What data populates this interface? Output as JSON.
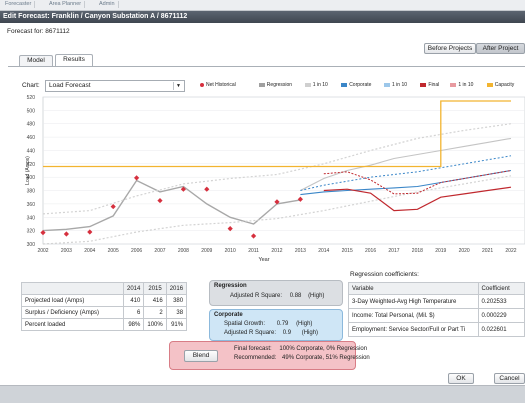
{
  "top_tabs": [
    "Forecaster",
    "Area Planner",
    "Admin"
  ],
  "window_title": "Edit Forecast: Franklin / Canyon Substation A / 8671112",
  "forecast_for_label": "Forecast for:",
  "forecast_for_value": "8671112",
  "buttons": {
    "before_projects": "Before Projects",
    "after_projects": "After Project",
    "blend": "Blend",
    "ok": "OK",
    "cancel": "Cancel"
  },
  "tabs": [
    {
      "label": "Model"
    },
    {
      "label": "Results"
    }
  ],
  "chart_label": "Chart:",
  "chart_select_value": "Load Forecast",
  "legend": [
    {
      "label": "Net Historical",
      "color": "#d6303e"
    },
    {
      "label": "Regression",
      "color": "#a0a0a0"
    },
    {
      "label": "1 in 10",
      "color": "#cfcfcf"
    },
    {
      "label": "Corporate",
      "color": "#3a86c8"
    },
    {
      "label": "1 in 10",
      "color": "#9cc7ea"
    },
    {
      "label": "Final",
      "color": "#c0282e"
    },
    {
      "label": "1 in 10",
      "color": "#e89aa0"
    },
    {
      "label": "Capacity",
      "color": "#f2b430"
    }
  ],
  "chart_data": {
    "type": "line",
    "xlabel": "Year",
    "ylabel": "Load (Amps)",
    "ylim": [
      300,
      520
    ],
    "xlim": [
      2002,
      2022
    ],
    "yticks": [
      300,
      320,
      340,
      360,
      380,
      400,
      420,
      440,
      460,
      480,
      500,
      520
    ],
    "xticks": [
      2002,
      2003,
      2004,
      2005,
      2006,
      2007,
      2008,
      2009,
      2010,
      2011,
      2012,
      2013,
      2014,
      2015,
      2016,
      2017,
      2018,
      2019,
      2020,
      2021,
      2022
    ],
    "series": [
      {
        "name": "Net Historical",
        "x": [
          2002,
          2003,
          2004,
          2005,
          2006,
          2007,
          2008,
          2009,
          2010,
          2011,
          2012,
          2013
        ],
        "y": [
          317,
          315,
          318,
          356,
          399,
          365,
          382,
          382,
          323,
          312,
          363,
          367
        ]
      },
      {
        "name": "Regression",
        "x": [
          2002,
          2003,
          2004,
          2005,
          2006,
          2007,
          2008,
          2009,
          2010,
          2011,
          2012,
          2013
        ],
        "y": [
          320,
          322,
          326,
          342,
          395,
          378,
          386,
          360,
          340,
          330,
          360,
          366
        ]
      },
      {
        "name": "1 in 10 (Regression) upper",
        "x": [
          2002,
          2004,
          2006,
          2008,
          2010,
          2012,
          2014,
          2016,
          2018,
          2020,
          2022
        ],
        "y": [
          345,
          350,
          372,
          390,
          398,
          404,
          420,
          440,
          458,
          470,
          480
        ]
      },
      {
        "name": "1 in 10 (Regression) lower",
        "x": [
          2002,
          2004,
          2006,
          2008,
          2010,
          2012,
          2014,
          2016,
          2018,
          2020,
          2022
        ],
        "y": [
          300,
          304,
          318,
          328,
          332,
          338,
          350,
          364,
          378,
          390,
          402
        ]
      },
      {
        "name": "Regression forecast",
        "x": [
          2013,
          2014,
          2015,
          2016,
          2017,
          2018,
          2019,
          2020,
          2021,
          2022
        ],
        "y": [
          380,
          398,
          410,
          418,
          428,
          434,
          440,
          446,
          452,
          458
        ]
      },
      {
        "name": "Corporate",
        "x": [
          2013,
          2014,
          2015,
          2016,
          2017,
          2018,
          2019,
          2020,
          2021,
          2022
        ],
        "y": [
          374,
          378,
          380,
          382,
          384,
          386,
          392,
          398,
          404,
          410
        ]
      },
      {
        "name": "1 in 10 (Corporate)",
        "x": [
          2013,
          2014,
          2015,
          2016,
          2017,
          2018,
          2019,
          2020,
          2021,
          2022
        ],
        "y": [
          380,
          388,
          394,
          400,
          404,
          408,
          414,
          420,
          426,
          432
        ]
      },
      {
        "name": "Final",
        "x": [
          2014,
          2015,
          2016,
          2017,
          2018,
          2019,
          2020,
          2021,
          2022
        ],
        "y": [
          380,
          382,
          376,
          350,
          352,
          370,
          375,
          380,
          385
        ]
      },
      {
        "name": "1 in 10 (Final)",
        "x": [
          2014,
          2015,
          2016,
          2017,
          2018,
          2019,
          2020,
          2021,
          2022
        ],
        "y": [
          405,
          408,
          396,
          375,
          376,
          392,
          398,
          404,
          410
        ]
      },
      {
        "name": "Capacity",
        "x": [
          2002,
          2019,
          2019,
          2022
        ],
        "y": [
          416,
          416,
          514,
          514
        ]
      }
    ]
  },
  "summary_table": {
    "headers": [
      "",
      "2014",
      "2015",
      "2016"
    ],
    "rows": [
      [
        "Projected load (Amps)",
        "410",
        "416",
        "380"
      ],
      [
        "Surplus / Deficiency (Amps)",
        "6",
        "2",
        "38"
      ],
      [
        "Percent loaded",
        "98%",
        "100%",
        "91%"
      ]
    ]
  },
  "regression_box": {
    "title": "Regression",
    "label": "Adjusted R Square:",
    "value": "0.88",
    "quality": "(High)"
  },
  "corporate_box": {
    "title": "Corporate",
    "spatial_label": "Spatial Growth:",
    "spatial_value": "0.79",
    "spatial_quality": "(High)",
    "r2_label": "Adjusted R Square:",
    "r2_value": "0.9",
    "r2_quality": "(High)"
  },
  "blend_box": {
    "final_label": "Final forecast:",
    "final_value": "100% Corporate, 0% Regression",
    "rec_label": "Recommended:",
    "rec_value": "49% Corporate, 51% Regression"
  },
  "coefficients": {
    "title": "Regression coefficients:",
    "headers": [
      "Variable",
      "Coefficient"
    ],
    "rows": [
      [
        "3-Day Weighted-Avg High Temperature",
        "0.202533"
      ],
      [
        "Income: Total Personal, (Mil. $)",
        "0.000229"
      ],
      [
        "Employment: Service Sector/Full or Part Ti",
        "0.022601"
      ]
    ]
  }
}
